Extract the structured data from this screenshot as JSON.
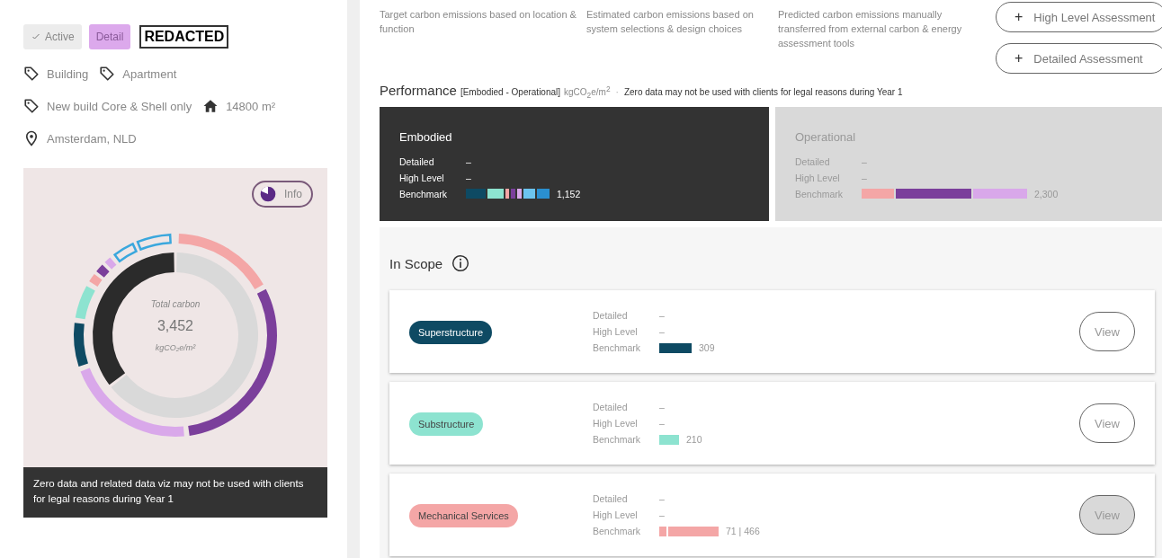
{
  "chips": [
    {
      "label": "Active",
      "selected": false,
      "checked": true
    },
    {
      "label": "Detail",
      "selected": true,
      "checked": false
    }
  ],
  "redacted": "REDACTED",
  "tags": [
    [
      {
        "kind": "tag",
        "text": "Building"
      },
      {
        "kind": "tag",
        "text": "Apartment"
      }
    ],
    [
      {
        "kind": "tag",
        "text": "New build Core & Shell only"
      },
      {
        "kind": "area",
        "text": "14800 m²"
      }
    ],
    [
      {
        "kind": "location",
        "text": "Amsterdam, NLD"
      }
    ]
  ],
  "chart_card": {
    "info_button": "Info",
    "center_label": "Total carbon",
    "center_value": "3,452",
    "center_unit": "kgCO₂e/m²",
    "note": "Zero data and related data viz may not be used with clients for legal reasons during Year 1"
  },
  "descriptions": [
    "Target carbon emissions based on location & function",
    "Estimated carbon emissions based on system selections & design choices",
    "Predicted carbon emissions manually transferred from external carbon & energy assessment tools"
  ],
  "actions": [
    {
      "icon": "+",
      "label": "High Level Assessment"
    },
    {
      "icon": "+",
      "label": "Detailed Assessment"
    }
  ],
  "performance": {
    "title": "Performance",
    "scope": "[Embodied - Operational]",
    "unit": "kgCO$_{2}$e/m$^{2}$",
    "separator": "·",
    "notice": "Zero data may not be used with clients for legal reasons during Year 1"
  },
  "panels": [
    {
      "kind": "dark",
      "title": "Embodied",
      "rows": [
        {
          "label": "Detailed",
          "value": "–"
        },
        {
          "label": "High Level",
          "value": "–"
        }
      ],
      "benchmark_label": "Benchmark",
      "benchmark_value": "1,152",
      "segments": [
        {
          "color": "#0e4a63"
        },
        {
          "color": "#8de3d0"
        },
        {
          "color": "#f4a6a6"
        },
        {
          "color": "#7b3f9b"
        },
        {
          "color": "#d9a8ea"
        },
        {
          "color": "#6cc4ef"
        },
        {
          "color": "#2a8fd0"
        }
      ]
    },
    {
      "kind": "light",
      "title": "Operational",
      "rows": [
        {
          "label": "Detailed",
          "value": "–"
        },
        {
          "label": "High Level",
          "value": "–"
        }
      ],
      "benchmark_label": "Benchmark",
      "benchmark_value": "2,300",
      "segments": [
        {
          "color": "#f4a6a6"
        },
        {
          "color": "#7b3f9b"
        },
        {
          "color": "#d9a8ea"
        }
      ]
    }
  ],
  "scope": {
    "title": "In Scope",
    "items": [
      {
        "label": "Superstructure",
        "color": "#0e4a63",
        "rows": [
          {
            "label": "Detailed",
            "value": "–"
          },
          {
            "label": "High Level",
            "value": "–"
          }
        ],
        "benchmark_label": "Benchmark",
        "benchmark_value": "309",
        "segments": [
          {
            "color": "#0e4a63"
          }
        ],
        "view": "View",
        "pressed": false
      },
      {
        "label": "Substructure",
        "color": "#8de3d0",
        "rows": [
          {
            "label": "Detailed",
            "value": "–"
          },
          {
            "label": "High Level",
            "value": "–"
          }
        ],
        "benchmark_label": "Benchmark",
        "benchmark_value": "210",
        "segments": [
          {
            "color": "#8de3d0"
          }
        ],
        "view": "View",
        "pressed": false
      },
      {
        "label": "Mechanical Services",
        "color": "#f4a6a6",
        "rows": [
          {
            "label": "Detailed",
            "value": "–"
          },
          {
            "label": "High Level",
            "value": "–"
          }
        ],
        "benchmark_label": "Benchmark",
        "benchmark_value": "71 | 466",
        "segments": [
          {
            "color": "#f4a6a6"
          },
          {
            "color": "#f4a6a6"
          }
        ],
        "view": "View",
        "pressed": true
      }
    ]
  }
}
